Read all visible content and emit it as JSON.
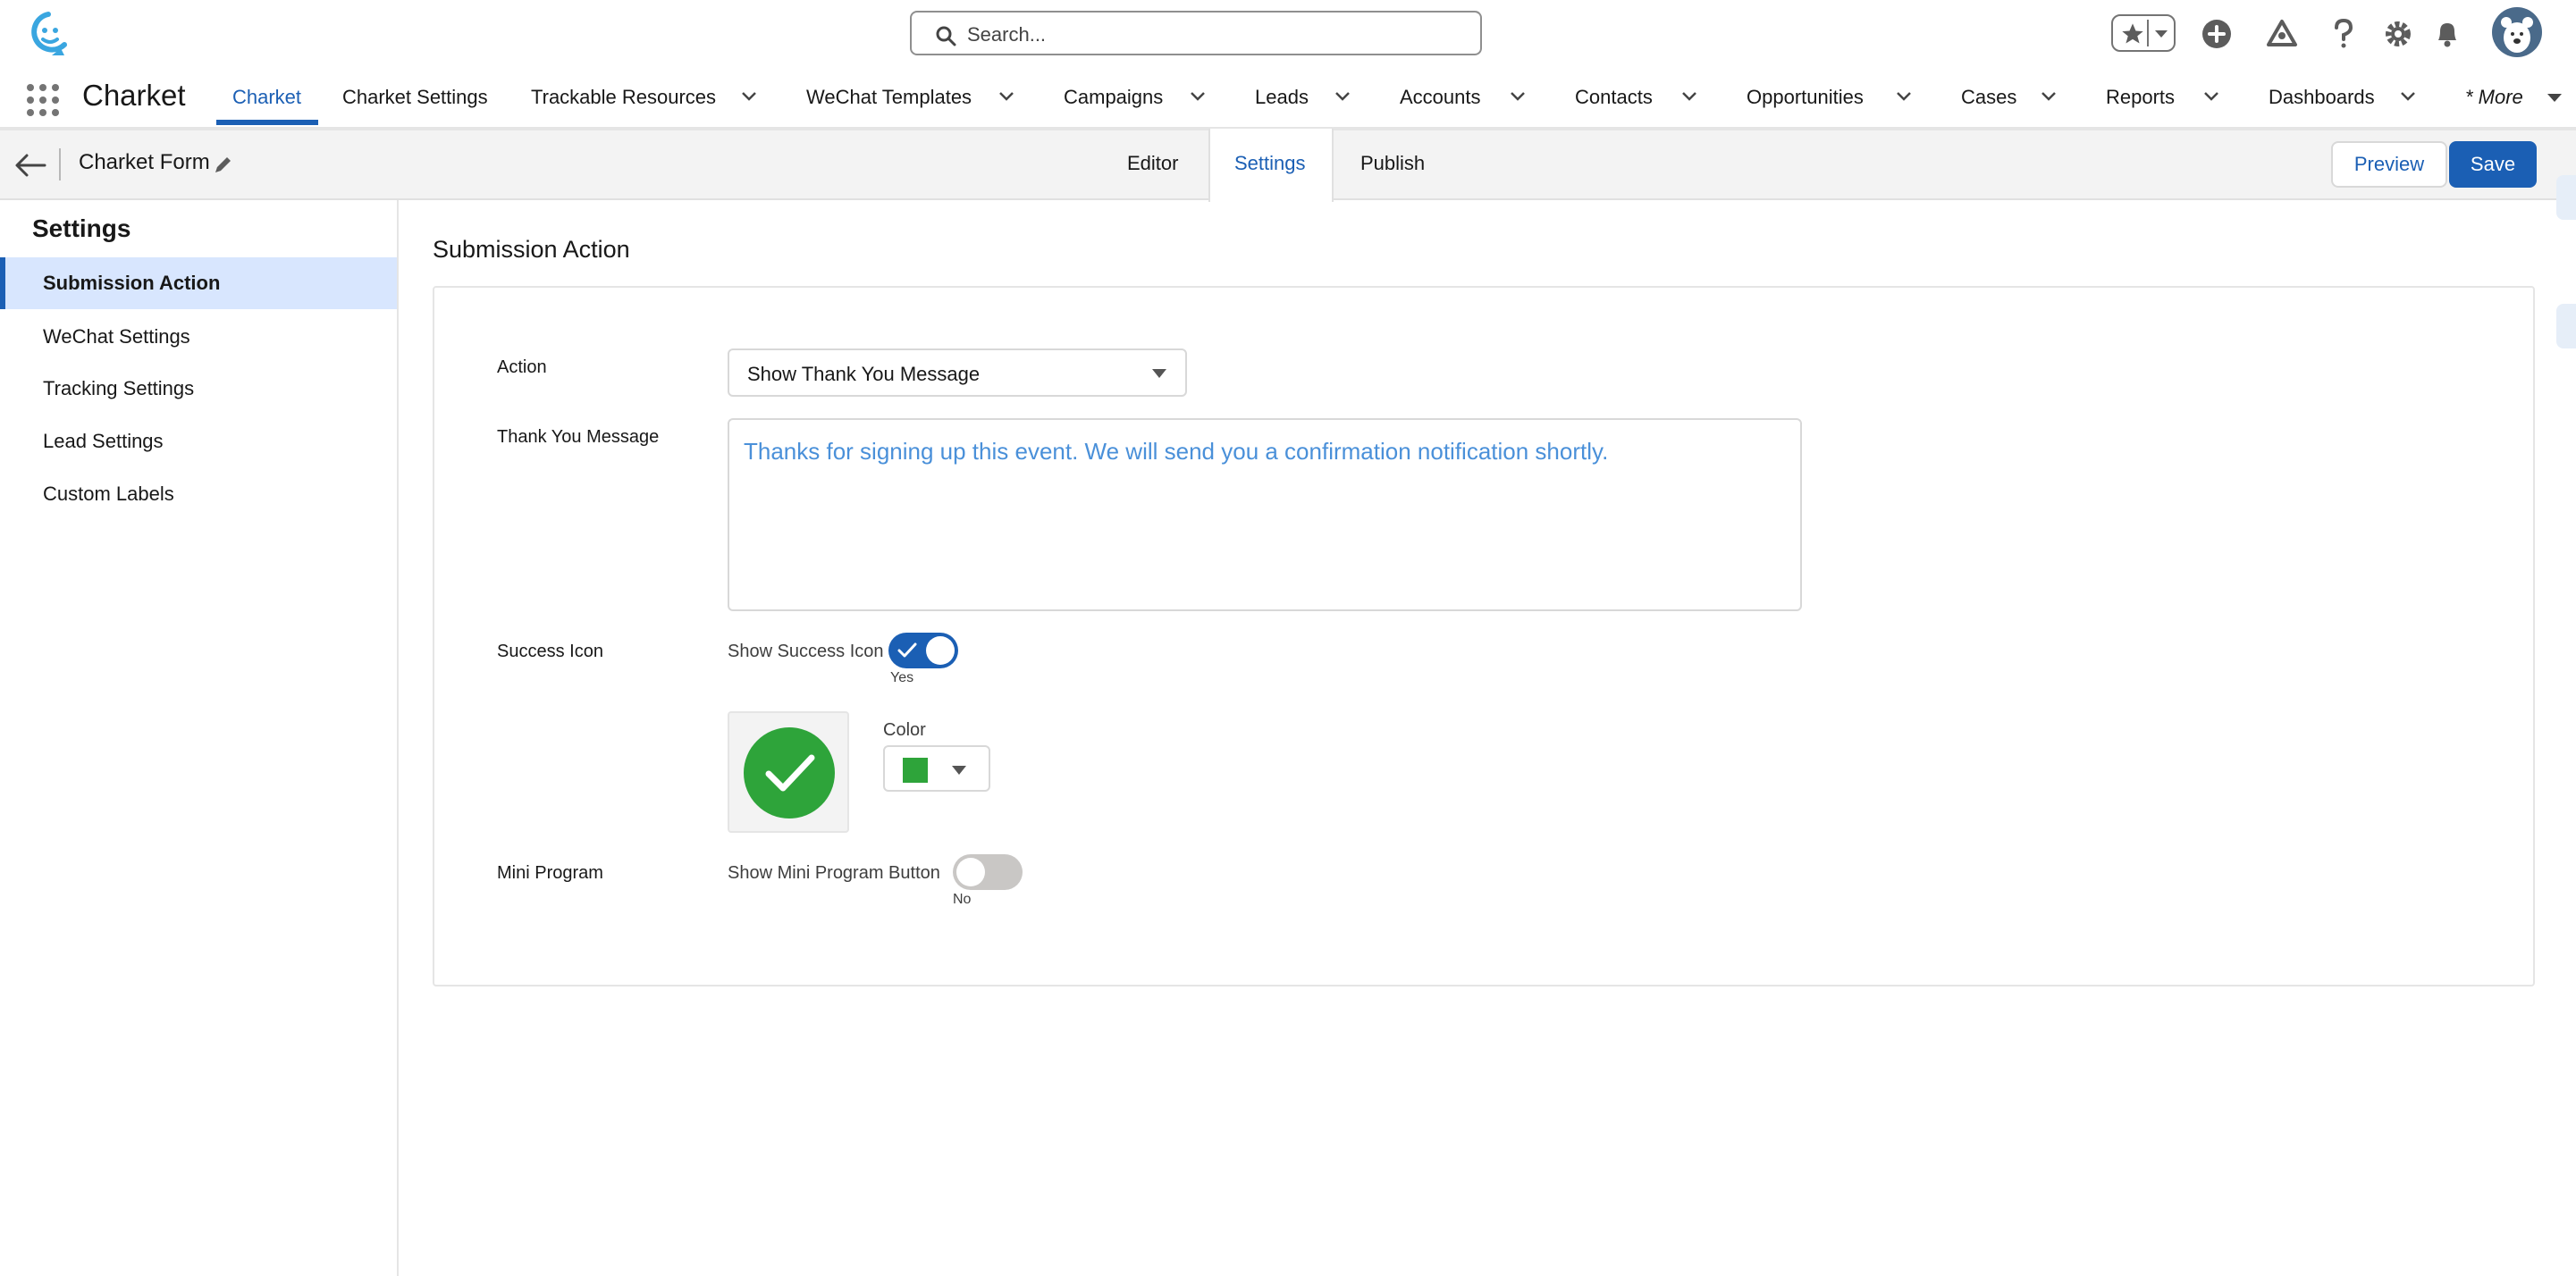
{
  "header": {
    "search_placeholder": "Search..."
  },
  "nav": {
    "app_name": "Charket",
    "items": [
      {
        "label": "Charket",
        "active": true
      },
      {
        "label": "Charket Settings"
      },
      {
        "label": "Trackable Resources"
      },
      {
        "label": "WeChat Templates"
      },
      {
        "label": "Campaigns"
      },
      {
        "label": "Leads"
      },
      {
        "label": "Accounts"
      },
      {
        "label": "Contacts"
      },
      {
        "label": "Opportunities"
      },
      {
        "label": "Cases"
      },
      {
        "label": "Reports"
      },
      {
        "label": "Dashboards"
      },
      {
        "label": "* More"
      }
    ]
  },
  "toolbar": {
    "form_name": "Charket Form",
    "tabs": [
      "Editor",
      "Settings",
      "Publish"
    ],
    "active_tab": "Settings",
    "preview_label": "Preview",
    "save_label": "Save"
  },
  "sidebar": {
    "title": "Settings",
    "items": [
      {
        "label": "Submission Action",
        "active": true
      },
      {
        "label": "WeChat Settings"
      },
      {
        "label": "Tracking Settings"
      },
      {
        "label": "Lead Settings"
      },
      {
        "label": "Custom Labels"
      }
    ]
  },
  "main": {
    "section_title": "Submission Action",
    "action": {
      "label": "Action",
      "value": "Show Thank You Message"
    },
    "thank_you": {
      "label": "Thank You Message",
      "value": "Thanks for signing up this event. We will send you a confirmation notification shortly."
    },
    "success_icon": {
      "label": "Success Icon",
      "toggle_label": "Show Success Icon",
      "toggle_on": true,
      "toggle_state": "Yes",
      "color_label": "Color",
      "color": "#2ea43a"
    },
    "mini_program": {
      "label": "Mini Program",
      "toggle_label": "Show Mini Program Button",
      "toggle_on": false,
      "toggle_state": "No"
    }
  },
  "colors": {
    "brand": "#1b5fb4",
    "success": "#2ea43a"
  }
}
